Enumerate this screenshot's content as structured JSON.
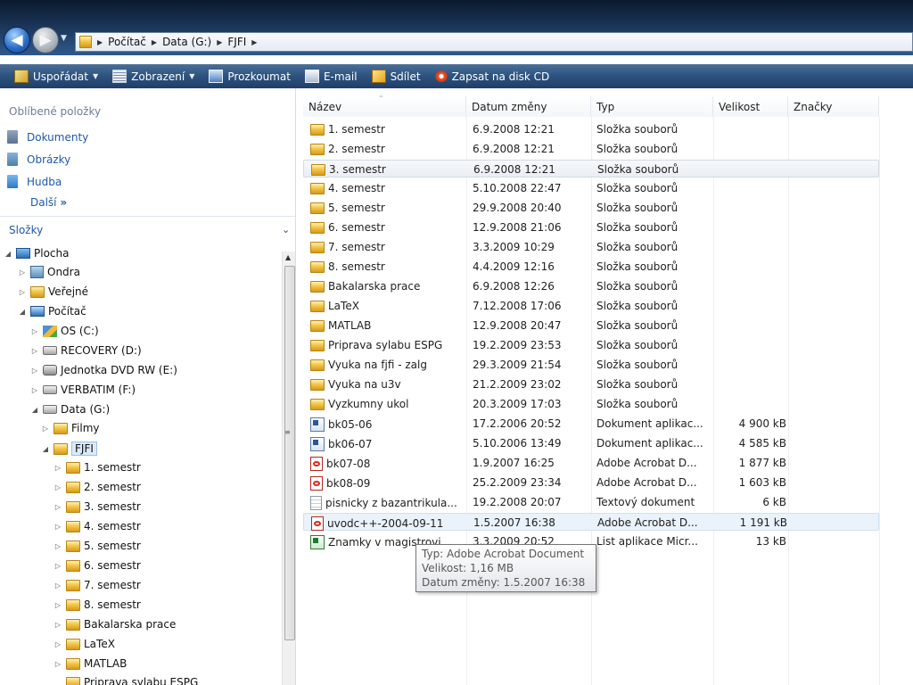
{
  "address": {
    "breadcrumbs": [
      "Počítač",
      "Data (G:)",
      "FJFI"
    ]
  },
  "toolbar": {
    "organize": "Uspořádat",
    "views": "Zobrazení",
    "explore": "Prozkoumat",
    "email": "E-mail",
    "share": "Sdílet",
    "burn": "Zapsat na disk CD"
  },
  "nav": {
    "favorites_header": "Oblíbené položky",
    "favorites": [
      "Dokumenty",
      "Obrázky",
      "Hudba"
    ],
    "more": "Další",
    "folders_header": "Složky",
    "tree": [
      {
        "label": "Plocha"
      },
      {
        "label": "Ondra"
      },
      {
        "label": "Veřejné"
      },
      {
        "label": "Počítač"
      },
      {
        "label": "OS (C:)"
      },
      {
        "label": "RECOVERY (D:)"
      },
      {
        "label": "Jednotka DVD RW (E:)"
      },
      {
        "label": "VERBATIM (F:)"
      },
      {
        "label": "Data (G:)"
      },
      {
        "label": "Filmy"
      },
      {
        "label": "FJFI"
      },
      {
        "label": "1. semestr"
      },
      {
        "label": "2. semestr"
      },
      {
        "label": "3. semestr"
      },
      {
        "label": "4. semestr"
      },
      {
        "label": "5. semestr"
      },
      {
        "label": "6. semestr"
      },
      {
        "label": "7. semestr"
      },
      {
        "label": "8. semestr"
      },
      {
        "label": "Bakalarska prace"
      },
      {
        "label": "LaTeX"
      },
      {
        "label": "MATLAB"
      },
      {
        "label": "Priprava sylabu ESPG"
      }
    ]
  },
  "list": {
    "columns": {
      "name": "Název",
      "date": "Datum změny",
      "type": "Typ",
      "size": "Velikost",
      "tags": "Značky"
    },
    "rows": [
      {
        "name": "1. semestr",
        "date": "6.9.2008 12:21",
        "type": "Složka souborů",
        "size": "",
        "icon": "folder"
      },
      {
        "name": "2. semestr",
        "date": "6.9.2008 12:21",
        "type": "Složka souborů",
        "size": "",
        "icon": "folder"
      },
      {
        "name": "3. semestr",
        "date": "6.9.2008 12:21",
        "type": "Složka souborů",
        "size": "",
        "icon": "folder"
      },
      {
        "name": "4. semestr",
        "date": "5.10.2008 22:47",
        "type": "Složka souborů",
        "size": "",
        "icon": "folder"
      },
      {
        "name": "5. semestr",
        "date": "29.9.2008 20:40",
        "type": "Složka souborů",
        "size": "",
        "icon": "folder"
      },
      {
        "name": "6. semestr",
        "date": "12.9.2008 21:06",
        "type": "Složka souborů",
        "size": "",
        "icon": "folder"
      },
      {
        "name": "7. semestr",
        "date": "3.3.2009 10:29",
        "type": "Složka souborů",
        "size": "",
        "icon": "folder"
      },
      {
        "name": "8. semestr",
        "date": "4.4.2009 12:16",
        "type": "Složka souborů",
        "size": "",
        "icon": "folder"
      },
      {
        "name": "Bakalarska prace",
        "date": "6.9.2008 12:26",
        "type": "Složka souborů",
        "size": "",
        "icon": "folder"
      },
      {
        "name": "LaTeX",
        "date": "7.12.2008 17:06",
        "type": "Složka souborů",
        "size": "",
        "icon": "folder"
      },
      {
        "name": "MATLAB",
        "date": "12.9.2008 20:47",
        "type": "Složka souborů",
        "size": "",
        "icon": "folder"
      },
      {
        "name": "Priprava sylabu ESPG",
        "date": "19.2.2009 23:53",
        "type": "Složka souborů",
        "size": "",
        "icon": "folder"
      },
      {
        "name": "Vyuka na fjfi - zalg",
        "date": "29.3.2009 21:54",
        "type": "Složka souborů",
        "size": "",
        "icon": "folder"
      },
      {
        "name": "Vyuka na u3v",
        "date": "21.2.2009 23:02",
        "type": "Složka souborů",
        "size": "",
        "icon": "folder"
      },
      {
        "name": "Vyzkumny ukol",
        "date": "20.3.2009 17:03",
        "type": "Složka souborů",
        "size": "",
        "icon": "folder"
      },
      {
        "name": "bk05-06",
        "date": "17.2.2006 20:52",
        "type": "Dokument aplikac...",
        "size": "4 900 kB",
        "icon": "word"
      },
      {
        "name": "bk06-07",
        "date": "5.10.2006 13:49",
        "type": "Dokument aplikac...",
        "size": "4 585 kB",
        "icon": "word"
      },
      {
        "name": "bk07-08",
        "date": "1.9.2007 16:25",
        "type": "Adobe Acrobat D...",
        "size": "1 877 kB",
        "icon": "pdf"
      },
      {
        "name": "bk08-09",
        "date": "25.2.2009 23:34",
        "type": "Adobe Acrobat D...",
        "size": "1 603 kB",
        "icon": "pdf"
      },
      {
        "name": "pisnicky z bazantrikula...",
        "date": "19.2.2008 20:07",
        "type": "Textový dokument",
        "size": "6 kB",
        "icon": "text"
      },
      {
        "name": "uvodc++-2004-09-11",
        "date": "1.5.2007 16:38",
        "type": "Adobe Acrobat D...",
        "size": "1 191 kB",
        "icon": "pdf"
      },
      {
        "name": "Znamky v magistrovi",
        "date": "3.3.2009 20:52",
        "type": "List aplikace Micr...",
        "size": "13 kB",
        "icon": "excel"
      }
    ]
  },
  "tooltip": {
    "type": "Typ: Adobe Acrobat Document",
    "size": "Velikost: 1,16 MB",
    "date": "Datum změny: 1.5.2007 16:38"
  }
}
